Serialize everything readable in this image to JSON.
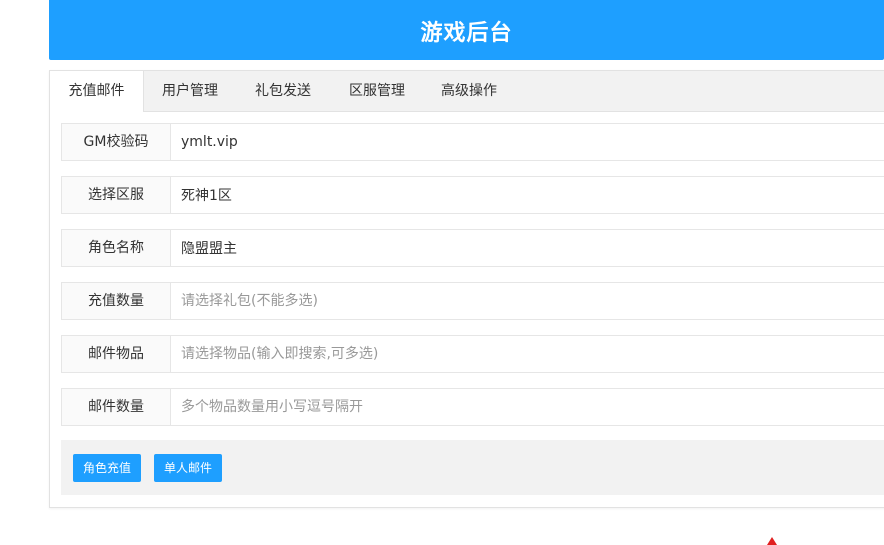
{
  "header": {
    "title": "游戏后台"
  },
  "tabs": [
    {
      "label": "充值邮件",
      "active": true
    },
    {
      "label": "用户管理",
      "active": false
    },
    {
      "label": "礼包发送",
      "active": false
    },
    {
      "label": "区服管理",
      "active": false
    },
    {
      "label": "高级操作",
      "active": false
    }
  ],
  "form": {
    "rows": [
      {
        "label": "GM校验码",
        "value": "ymlt.vip",
        "placeholder": ""
      },
      {
        "label": "选择区服",
        "value": "死神1区",
        "placeholder": ""
      },
      {
        "label": "角色名称",
        "value": "隐盟盟主",
        "placeholder": ""
      },
      {
        "label": "充值数量",
        "value": "",
        "placeholder": "请选择礼包(不能多选)"
      },
      {
        "label": "邮件物品",
        "value": "",
        "placeholder": "请选择物品(输入即搜索,可多选)"
      },
      {
        "label": "邮件数量",
        "value": "",
        "placeholder": "多个物品数量用小写逗号隔开"
      }
    ]
  },
  "actions": {
    "recharge_label": "角色充值",
    "mail_label": "单人邮件"
  },
  "colors": {
    "accent": "#1e9fff",
    "tab_bar": "#f2f2f2",
    "corner_mark": "#e02020"
  }
}
